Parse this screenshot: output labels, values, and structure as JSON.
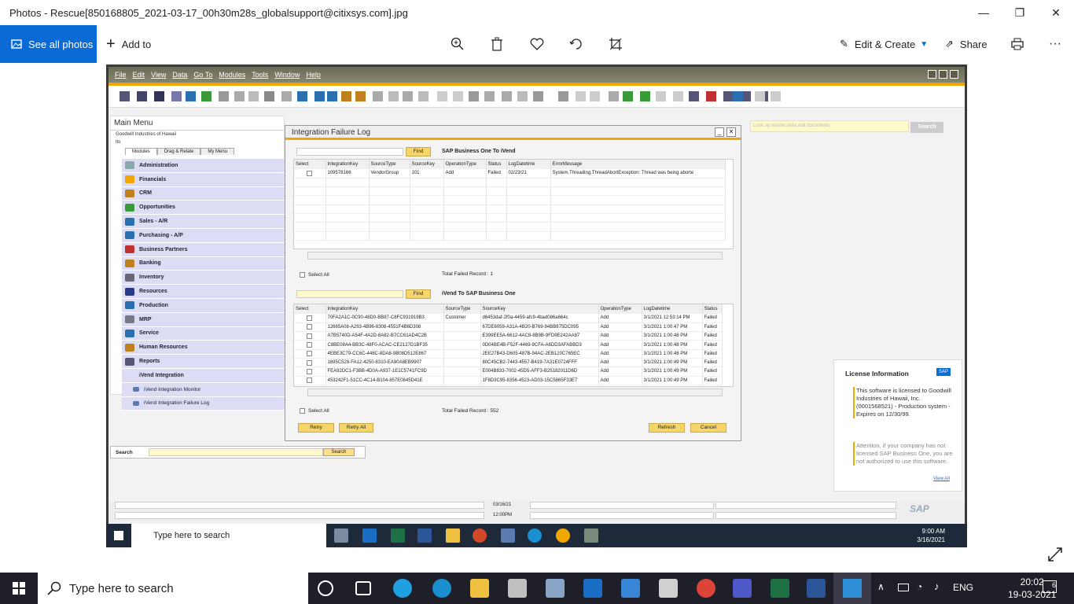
{
  "window": {
    "title": "Photos - Rescue[850168805_2021-03-17_00h30m28s_globalsupport@citixsys.com].jpg",
    "minimize": "—",
    "restore": "❐",
    "close": "✕"
  },
  "photos_toolbar": {
    "see_all": "See all photos",
    "add_to": "Add to",
    "edit_create": "Edit & Create",
    "share": "Share",
    "more": "···"
  },
  "sap": {
    "menu": [
      "File",
      "Edit",
      "View",
      "Data",
      "Go To",
      "Modules",
      "Tools",
      "Window",
      "Help"
    ],
    "main_menu": {
      "title": "Main Menu",
      "company": "Goodwill Industries of Hawaii",
      "user": "tlo",
      "tabs": [
        "Modules",
        "Drag & Relate",
        "My Menu"
      ],
      "items": [
        "Administration",
        "Financials",
        "CRM",
        "Opportunities",
        "Sales - A/R",
        "Purchasing - A/P",
        "Business Partners",
        "Banking",
        "Inventory",
        "Resources",
        "Production",
        "MRP",
        "Service",
        "Human Resources",
        "Reports",
        "iVend Integration"
      ],
      "sub_items": [
        "iVend Integration Monitor",
        "iVend Integration Failure Log"
      ]
    },
    "search": {
      "label": "Search",
      "button": "Search"
    },
    "lookup": {
      "placeholder": "Look up master data and documents",
      "button": "Search"
    },
    "dialog": {
      "title": "Integration Failure Log",
      "find": "Find",
      "section1": "SAP Business One To iVend",
      "grid1_headers": [
        "Select",
        "IntegrationKey",
        "SourceType",
        "SourceKey",
        "OperationType",
        "Status",
        "LogDatetime",
        "ErrorMessage"
      ],
      "grid1_rows": [
        [
          "",
          "109578166",
          "VendorGroup",
          "101",
          "Add",
          "Failed",
          "02/23/21",
          "System.Threading.ThreadAbortException: Thread was being aborte"
        ]
      ],
      "select_all": "Select All",
      "total1": "Total Failed Record : 1",
      "section2": "iVend To SAP Business One",
      "grid2_headers": [
        "Select",
        "IntegrationKey",
        "SourceType",
        "SourceKey",
        "OperationType",
        "LogDatetime",
        "Status"
      ],
      "grid2_rows": [
        [
          "",
          "70FA2A1C-0C90-48D0-BB87-C8FC931919B3",
          "Customer",
          "d6453daf-2f0a-4459-afc9-4bad086a664c",
          "Add",
          "3/1/2021 12:53:14 PM",
          "Failed"
        ],
        [
          "",
          "12665A08-A293-4B96-8308-4551F4B6D308",
          "",
          "67DE6059-A31A-4B20-B769-94BB875DC095",
          "Add",
          "3/1/2021 1:00:47 PM",
          "Failed"
        ],
        [
          "",
          "A7B5740D-A54F-4A2D-8A82-B7CC61AD4C2B",
          "",
          "E399EE5A-6612-4AC8-8B9B-9FD9E242AA87",
          "Add",
          "3/1/2021 1:00:48 PM",
          "Failed"
        ],
        [
          "",
          "C8BE08A4-BB3C-48F0-ACAC-CE2127D1BF35",
          "",
          "0D04BE4B-F52F-4469-9CFA-A6DD3AFABBD3",
          "Add",
          "3/1/2021 1:00:48 PM",
          "Failed"
        ],
        [
          "",
          "4EBE3C79-CC6C-448C-8DA8-9B08D512E867",
          "",
          "2EE27B43-D605-487B-94AC-2EB120C765EC",
          "Add",
          "3/1/2021 1:00:48 PM",
          "Failed"
        ],
        [
          "",
          "1695C528-FA12-4250-8310-EA90A8EB9907",
          "",
          "80C45CB2-7443-4557-B419-7A31E0724FFF",
          "Add",
          "3/1/2021 1:00:49 PM",
          "Failed"
        ],
        [
          "",
          "FEA92DC1-F3BB-4D0A-A937-1E1C5741FC9D",
          "",
          "E004B833-7002-45D5-AFF3-B25182011D6D",
          "Add",
          "3/1/2021 1:00:49 PM",
          "Failed"
        ],
        [
          "",
          "453242F1-51CC-4C14-B104-857E0845D41E",
          "",
          "1F8D3C95-8356-4523-AD03-15C5865F33E7",
          "Add",
          "3/1/2021 1:00:49 PM",
          "Failed"
        ]
      ],
      "total2": "Total Failed Record : 552",
      "retry": "Retry",
      "retry_all": "Retry All",
      "refresh": "Refresh",
      "cancel": "Cancel"
    },
    "license": {
      "title": "License Information",
      "body": "This software is licensed to Goodwill Industries of Hawaii, Inc. (0001568521) - Production system - Expires on 12/30/99.",
      "warning": "Attention, if your company has not licensed SAP Business One, you are not authorized to use this software.",
      "link": "View All"
    },
    "status": {
      "date": "03/16/21",
      "time": "12:00PM"
    },
    "logo": "SAP"
  },
  "inner_taskbar": {
    "search": "Type here to search",
    "time": "9:00 AM",
    "date": "3/16/2021"
  },
  "taskbar": {
    "search": "Type here to search",
    "lang": "ENG",
    "time": "20:02",
    "date": "19-03-2021",
    "notif": "6"
  }
}
